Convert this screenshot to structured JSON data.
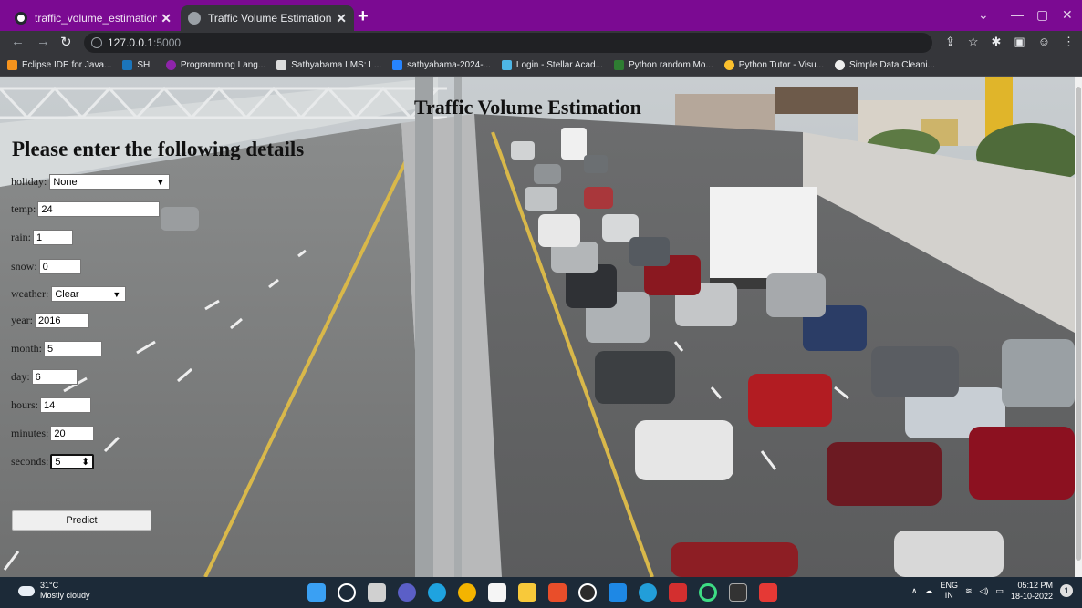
{
  "browser": {
    "tabs": [
      {
        "label": "traffic_volume_estimation_projec",
        "icon": "github-icon"
      },
      {
        "label": "Traffic Volume Estimation",
        "icon": "globe-icon"
      }
    ],
    "url_host": "127.0.0.1",
    "url_port": ":5000",
    "bookmarks": [
      {
        "label": "Eclipse IDE for Java...",
        "color": "#f7941d"
      },
      {
        "label": "SHL",
        "color": "#1b75bb"
      },
      {
        "label": "Programming Lang...",
        "color": "#6a1b9a"
      },
      {
        "label": "Sathyabama LMS: L...",
        "color": "#ffffff"
      },
      {
        "label": "sathyabama-2024-...",
        "color": "#2684ff"
      },
      {
        "label": "Login - Stellar Acad...",
        "color": "#4db6e6"
      },
      {
        "label": "Python random Mo...",
        "color": "#2e7d32"
      },
      {
        "label": "Python Tutor - Visu...",
        "color": "#fbc02d"
      },
      {
        "label": "Simple Data Cleani...",
        "color": "#ffffff"
      }
    ]
  },
  "page": {
    "title": "Traffic Volume Estimation",
    "heading": "Please enter the following details",
    "fields": [
      {
        "label": "holiday:",
        "value": "None",
        "type": "select"
      },
      {
        "label": "temp:",
        "value": "24",
        "type": "text"
      },
      {
        "label": "rain:",
        "value": "1",
        "type": "text"
      },
      {
        "label": "snow:",
        "value": "0",
        "type": "text"
      },
      {
        "label": "weather:",
        "value": "Clear",
        "type": "select"
      },
      {
        "label": "year:",
        "value": "2016",
        "type": "text"
      },
      {
        "label": "month:",
        "value": "5",
        "type": "text"
      },
      {
        "label": "day:",
        "value": "6",
        "type": "text"
      },
      {
        "label": "hours:",
        "value": "14",
        "type": "text"
      },
      {
        "label": "minutes:",
        "value": "20",
        "type": "text"
      },
      {
        "label": "seconds:",
        "value": "5",
        "type": "number"
      }
    ],
    "predict_label": "Predict"
  },
  "taskbar": {
    "temperature": "31°C",
    "weather": "Mostly cloudy",
    "lang": "ENG",
    "region": "IN",
    "time": "05:12 PM",
    "date": "18-10-2022",
    "notifications": "1"
  }
}
